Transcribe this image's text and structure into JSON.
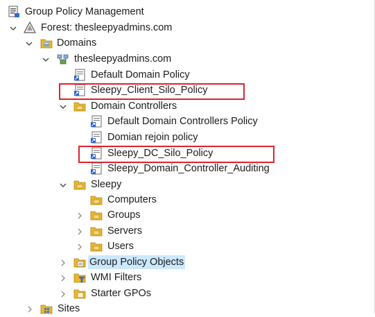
{
  "tree": {
    "root": {
      "label": "Group Policy Management",
      "icon": "gpm-console-icon"
    },
    "forest": {
      "label": "Forest: thesleepyadmins.com",
      "icon": "forest-icon",
      "state": "expanded"
    },
    "domains": {
      "label": "Domains",
      "icon": "folder-icon",
      "state": "expanded"
    },
    "domain": {
      "label": "thesleepyadmins.com",
      "icon": "domain-icon",
      "state": "expanded"
    },
    "default_domain_policy": {
      "label": "Default Domain Policy",
      "icon": "gpo-link-icon"
    },
    "client_silo_policy": {
      "label": "Sleepy_Client_Silo_Policy",
      "icon": "gpo-link-icon",
      "highlighted": true
    },
    "domain_controllers": {
      "label": "Domain Controllers",
      "icon": "ou-icon",
      "state": "expanded"
    },
    "default_dc_policy": {
      "label": "Default Domain Controllers Policy",
      "icon": "gpo-link-icon"
    },
    "rejoin_policy": {
      "label": "Domian rejoin policy",
      "icon": "gpo-link-icon"
    },
    "dc_silo_policy": {
      "label": "Sleepy_DC_Silo_Policy",
      "icon": "gpo-link-icon",
      "highlighted": true
    },
    "dc_auditing": {
      "label": "Sleepy_Domain_Controller_Auditing",
      "icon": "gpo-link-icon"
    },
    "sleepy_ou": {
      "label": "Sleepy",
      "icon": "ou-icon",
      "state": "expanded"
    },
    "computers": {
      "label": "Computers",
      "icon": "ou-icon"
    },
    "groups": {
      "label": "Groups",
      "icon": "ou-icon",
      "state": "collapsed"
    },
    "servers": {
      "label": "Servers",
      "icon": "ou-icon",
      "state": "collapsed"
    },
    "users": {
      "label": "Users",
      "icon": "ou-icon",
      "state": "collapsed"
    },
    "gpo_objects": {
      "label": "Group Policy Objects",
      "icon": "gpo-container-icon",
      "state": "collapsed",
      "selected": true
    },
    "wmi_filters": {
      "label": "WMI Filters",
      "icon": "wmi-filter-icon",
      "state": "collapsed"
    },
    "starter_gpos": {
      "label": "Starter GPOs",
      "icon": "starter-gpo-icon",
      "state": "collapsed"
    },
    "sites": {
      "label": "Sites",
      "icon": "sites-icon",
      "state": "collapsed"
    }
  },
  "colors": {
    "highlight_box": "#e0212e",
    "selection": "#cce8ff",
    "folder": "#e9b62f"
  }
}
